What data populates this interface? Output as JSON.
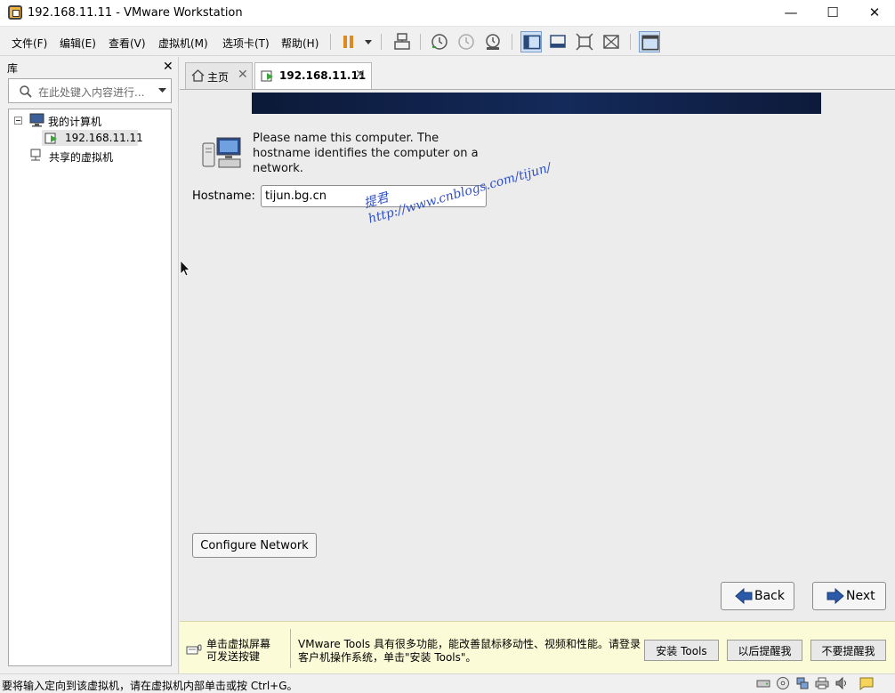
{
  "window": {
    "title": "192.168.11.11 - VMware Workstation",
    "minimize": "—",
    "maximize": "☐",
    "close": "✕"
  },
  "menu": {
    "file": "文件(F)",
    "edit": "编辑(E)",
    "view": "查看(V)",
    "vm": "虚拟机(M)",
    "tabs": "选项卡(T)",
    "help": "帮助(H)"
  },
  "library": {
    "header": "库",
    "close": "✕",
    "search_placeholder": "在此处键入内容进行...",
    "tree": {
      "my_computer": "我的计算机",
      "vm": "192.168.11.11",
      "shared": "共享的虚拟机"
    }
  },
  "tabs": [
    {
      "label": "主页",
      "close": "✕"
    },
    {
      "label": "192.168.11.11",
      "close": "✕"
    }
  ],
  "installer": {
    "intro": "Please name this computer.  The hostname identifies the computer on a network.",
    "hostname_label": "Hostname:",
    "hostname_value": "tijun.bg.cn",
    "watermark_name": "提君",
    "watermark_url": "http://www.cnblogs.com/tijun/",
    "configure_network": "Configure Network",
    "back": "Back",
    "next": "Next"
  },
  "hint": {
    "left": "单击虚拟屏幕可发送按键",
    "message": "VMware Tools 具有很多功能，能改善鼠标移动性、视频和性能。请登录客户机操作系统，单击\"安装 Tools\"。",
    "install_tools": "安装 Tools",
    "remind_later": "以后提醒我",
    "never_remind": "不要提醒我"
  },
  "status": {
    "text": "要将输入定向到该虚拟机，请在虚拟机内部单击或按 Ctrl+G。"
  }
}
